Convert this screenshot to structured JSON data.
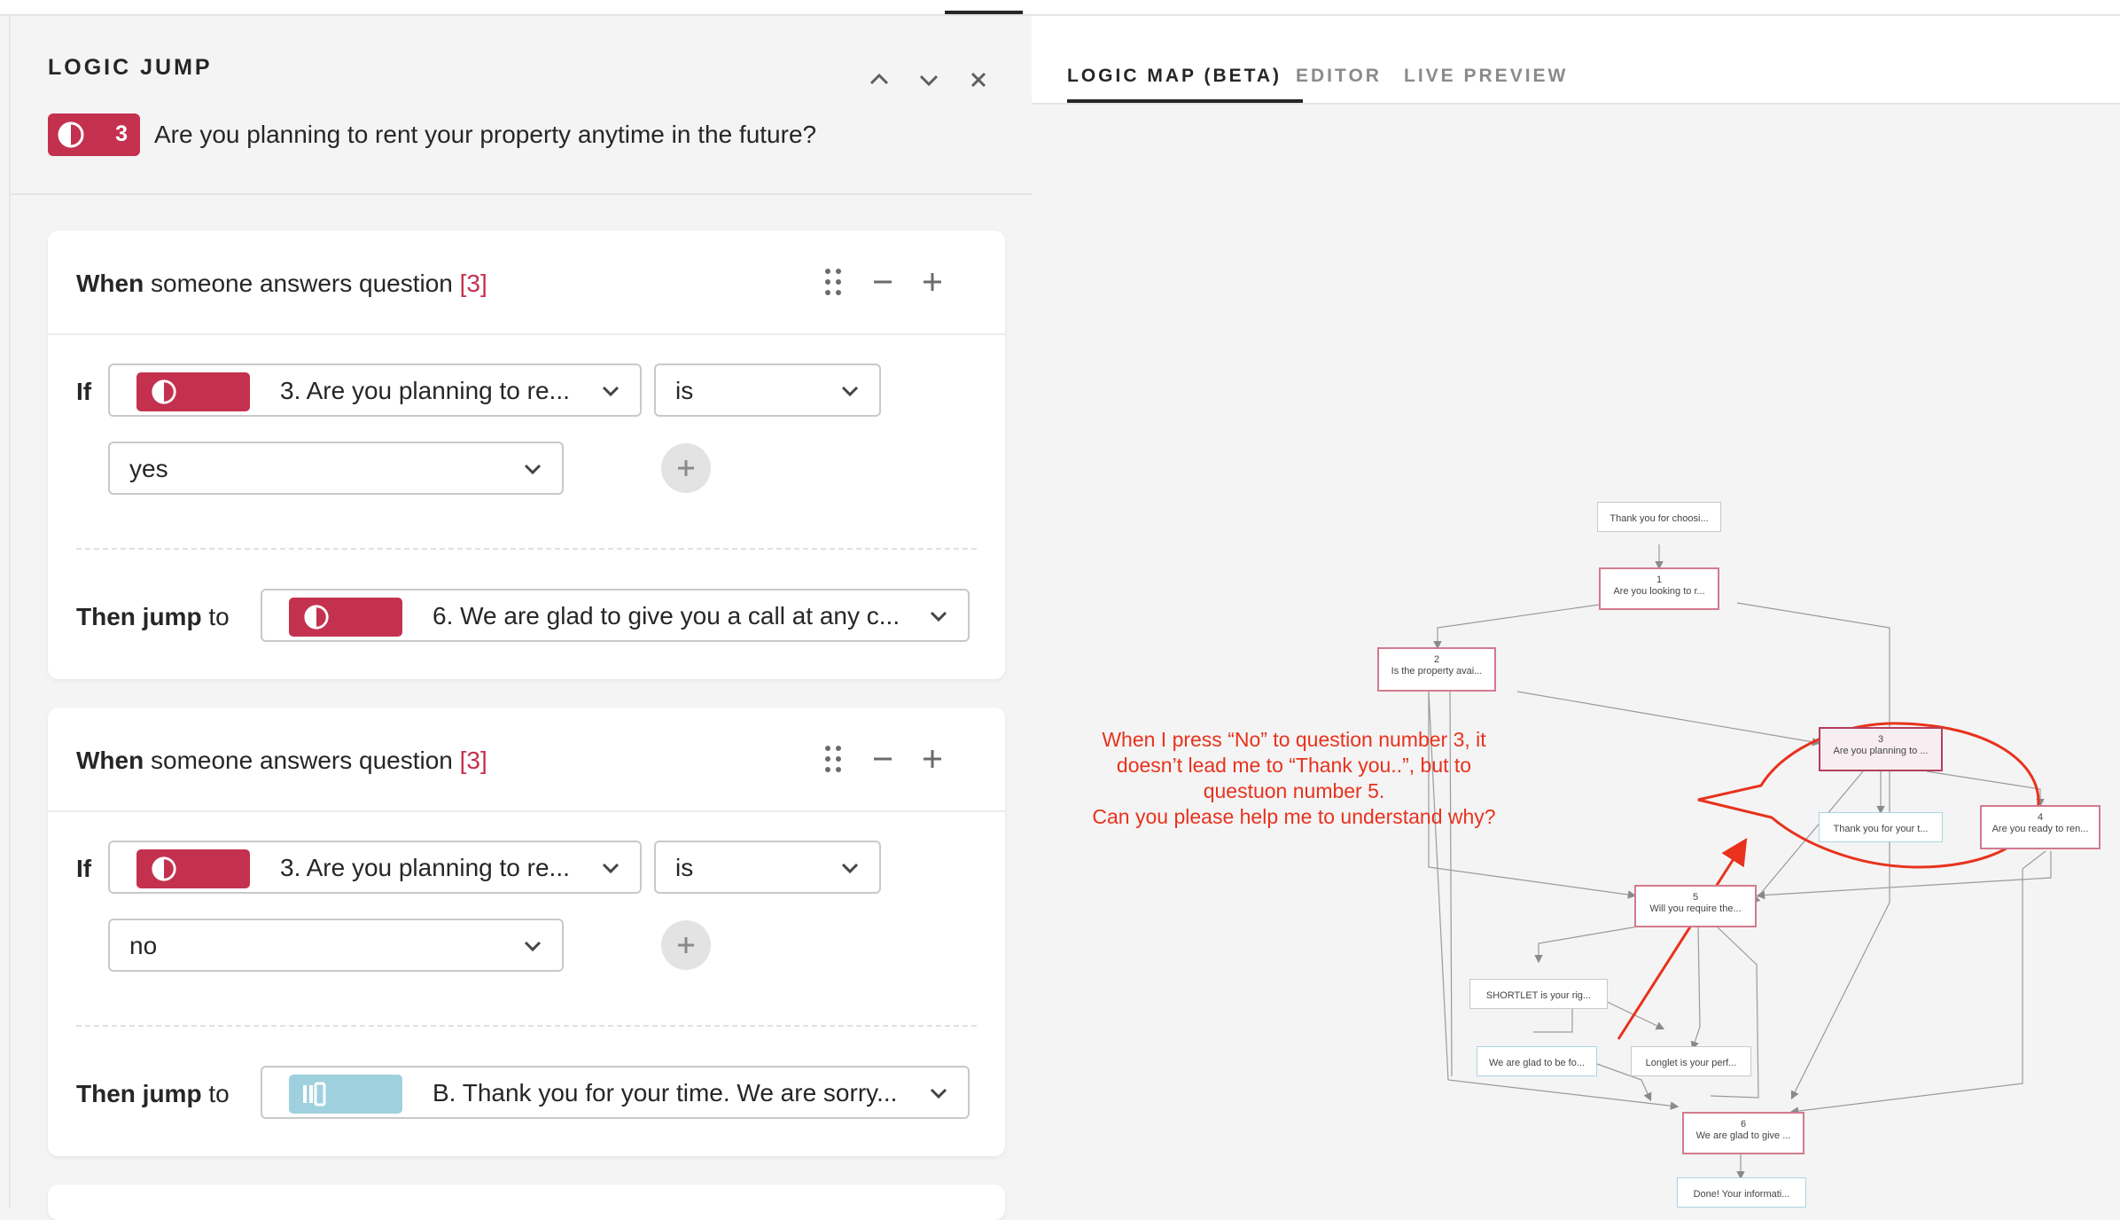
{
  "left_panel": {
    "title": "LOGIC JUMP",
    "question": {
      "number": "3",
      "text": "Are you planning to rent your property anytime in the future?"
    },
    "rules": [
      {
        "when_bold": "When",
        "when_text": " someone answers question ",
        "question_ref": "[3]",
        "if_label": "If",
        "question_select": "3. Are you planning to re...",
        "operator": "is",
        "value": "yes",
        "then_bold": "Then jump",
        "then_text": " to",
        "destination": "6. We are glad to give you a call at any c..."
      },
      {
        "when_bold": "When",
        "when_text": " someone answers question ",
        "question_ref": "[3]",
        "if_label": "If",
        "question_select": "3. Are you planning to re...",
        "operator": "is",
        "value": "no",
        "then_bold": "Then jump",
        "then_text": " to",
        "destination": "B. Thank you for your time. We are sorry..."
      }
    ]
  },
  "right_panel": {
    "tabs": [
      "LOGIC MAP (BETA)",
      "EDITOR",
      "LIVE PREVIEW"
    ],
    "active_tab": "LOGIC MAP (BETA)",
    "map_nodes": {
      "welcome": "Thank you for choosi...",
      "q1": {
        "num": "1",
        "label": "Are you looking to r..."
      },
      "q2": {
        "num": "2",
        "label": "Is the property avai..."
      },
      "q3": {
        "num": "3",
        "label": "Are you planning to ..."
      },
      "thanks": "Thank you for your t...",
      "q4": {
        "num": "4",
        "label": "Are you ready to ren..."
      },
      "q5": {
        "num": "5",
        "label": "Will you require the..."
      },
      "shortlet": "SHORTLET is your rig...",
      "glad": "We are glad to be fo...",
      "longlet": "Longlet is your perf...",
      "q6": {
        "num": "6",
        "label": "We are glad to give ..."
      },
      "done": "Done! Your informati..."
    },
    "annotation": [
      "When I press “No” to question number 3, it",
      "doesn’t lead me to “Thank you..”, but to",
      "questuon number 5.",
      "Can you please help me to understand why?"
    ]
  },
  "colors": {
    "brand_red": "#c4314f",
    "statement_blue": "#9ed1dd",
    "annotation_red": "#e8321d"
  }
}
